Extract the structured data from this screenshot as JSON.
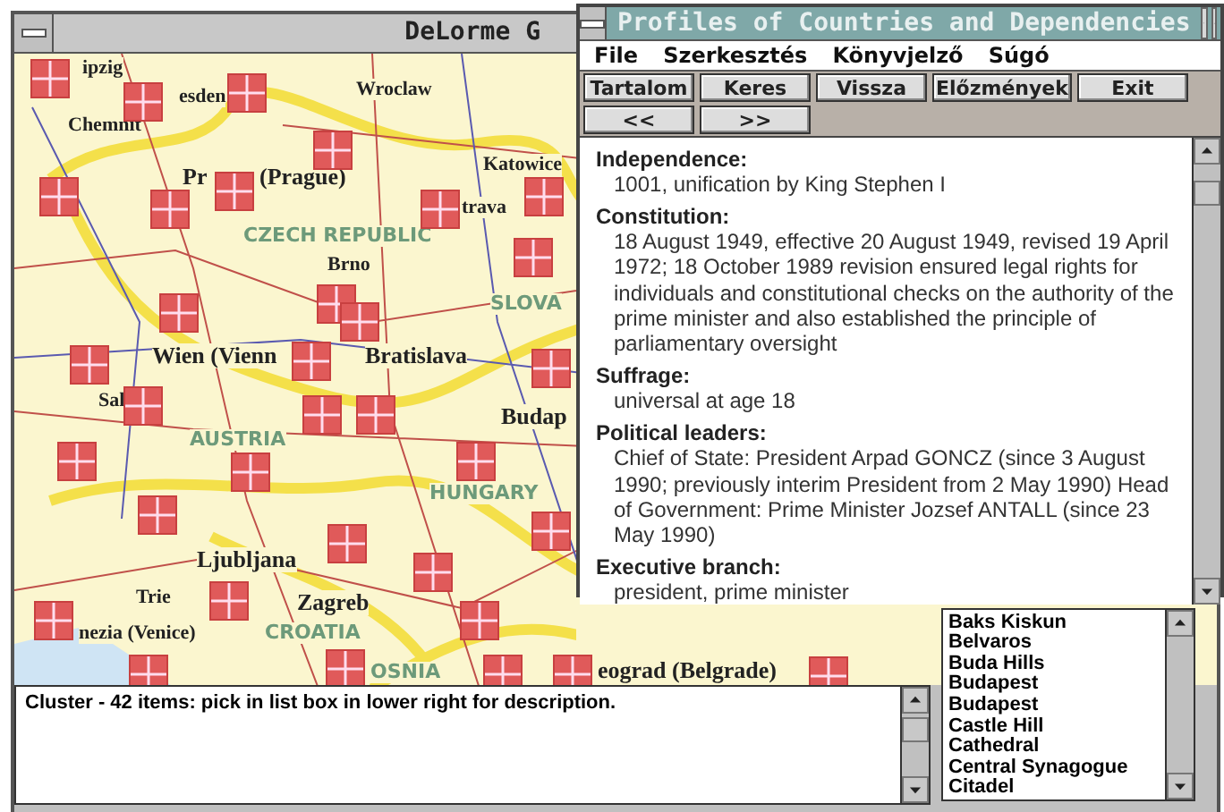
{
  "map_window": {
    "title": "DeLorme G",
    "map_labels": [
      {
        "text": "ipzig",
        "kind": "city"
      },
      {
        "text": "esden",
        "kind": "city"
      },
      {
        "text": "Chemnit",
        "kind": "city"
      },
      {
        "text": "Wroclaw",
        "kind": "city"
      },
      {
        "text": "Pr",
        "kind": "capital"
      },
      {
        "text": "(Prague)",
        "kind": "capital"
      },
      {
        "text": "Katowice",
        "kind": "city"
      },
      {
        "text": "trava",
        "kind": "city"
      },
      {
        "text": "CZECH REPUBLIC",
        "kind": "country"
      },
      {
        "text": "Brno",
        "kind": "city"
      },
      {
        "text": "SLOVA",
        "kind": "country"
      },
      {
        "text": "Wien (Vienn",
        "kind": "capital"
      },
      {
        "text": "Bratislava",
        "kind": "capital"
      },
      {
        "text": "Sal",
        "kind": "city"
      },
      {
        "text": "AUSTRIA",
        "kind": "country"
      },
      {
        "text": "Budap",
        "kind": "capital"
      },
      {
        "text": "HUNGARY",
        "kind": "country"
      },
      {
        "text": "Ljubljana",
        "kind": "capital"
      },
      {
        "text": "Trie",
        "kind": "city"
      },
      {
        "text": "nezia (Venice)",
        "kind": "city"
      },
      {
        "text": "Zagreb",
        "kind": "capital"
      },
      {
        "text": "CROATIA",
        "kind": "country"
      },
      {
        "text": "OSNIA",
        "kind": "country"
      },
      {
        "text": "eograd (Belgrade)",
        "kind": "capital"
      }
    ],
    "description": "Cluster - 42 items: pick in list box in lower right for description.",
    "list_items": [
      "Baks Kiskun",
      "Belvaros",
      "Buda Hills",
      "Budapest",
      "Budapest",
      "Castle Hill",
      "Cathedral",
      "Central Synagogue",
      "Citadel"
    ]
  },
  "profiles_window": {
    "title": "Profiles of Countries and Dependencies",
    "menu": [
      "File",
      "Szerkesztés",
      "Könyvjelző",
      "Súgó"
    ],
    "buttons_row_1": [
      "Tartalom",
      "Keres",
      "Vissza",
      "Előzmények",
      "Exit"
    ],
    "buttons_row_2": [
      "<<",
      ">>"
    ],
    "sections": [
      {
        "heading": "Independence:",
        "text": "1001, unification by King Stephen I"
      },
      {
        "heading": "Constitution:",
        "text": "18 August 1949, effective 20 August 1949, revised 19 April 1972; 18 October 1989 revision ensured legal rights for individuals and constitutional checks on the authority of the prime minister and also established the principle of parliamentary oversight"
      },
      {
        "heading": "Suffrage:",
        "text": "universal at age 18"
      },
      {
        "heading": "Political leaders:",
        "text": "Chief of State: President Arpad GONCZ (since 3 August 1990; previously interim President from 2 May 1990) Head of Government: Prime Minister Jozsef ANTALL (since 23 May 1990)"
      },
      {
        "heading": "Executive branch:",
        "text": "president, prime minister"
      }
    ]
  }
}
